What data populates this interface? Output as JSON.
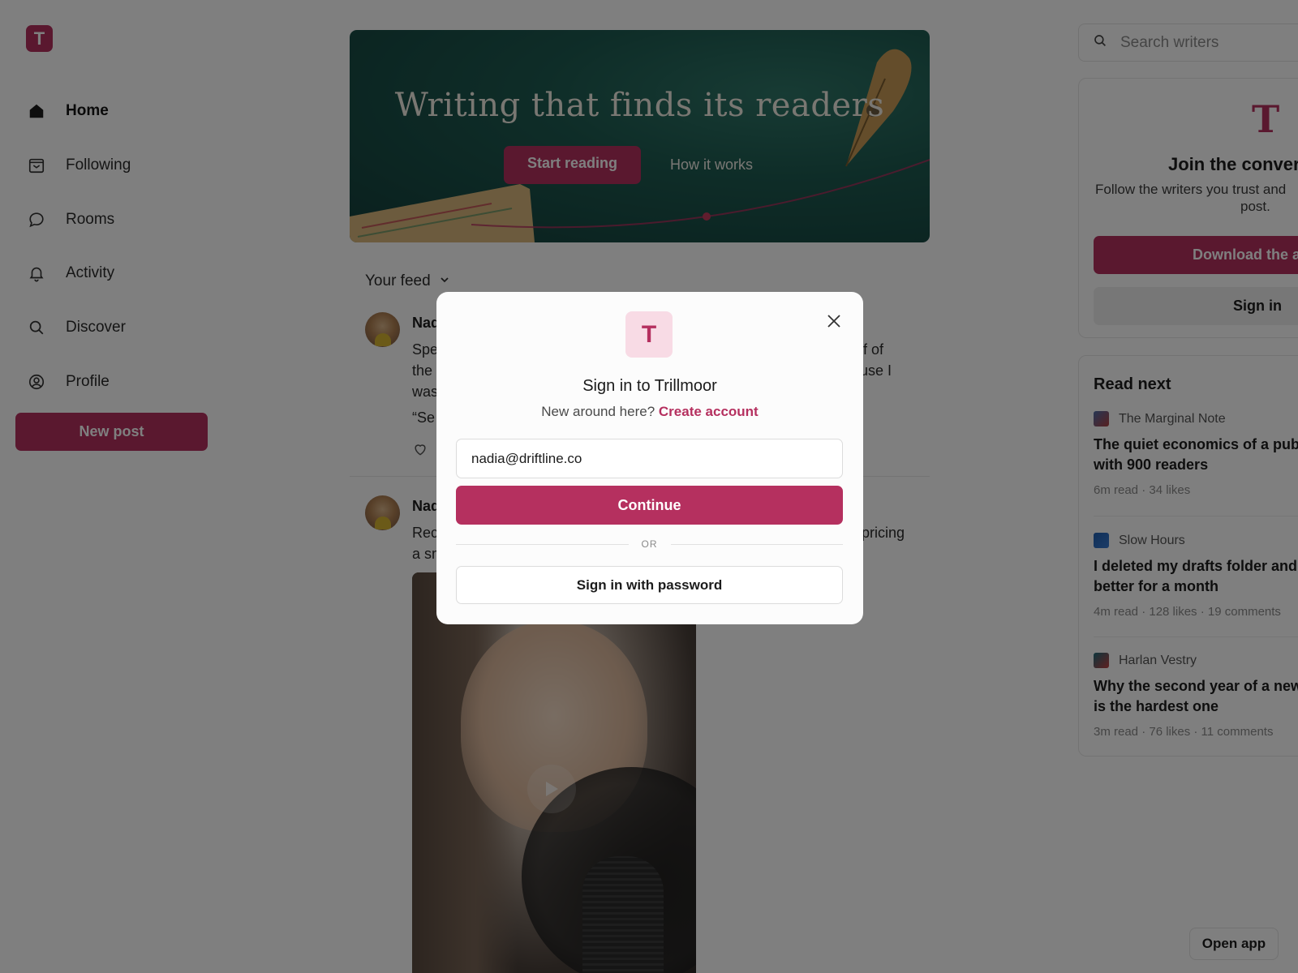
{
  "app": {
    "logo_letter": "T",
    "brand_color": "#b5305f"
  },
  "sidebar": {
    "items": [
      {
        "label": "Home",
        "icon": "home-icon",
        "active": true
      },
      {
        "label": "Following",
        "icon": "inbox-icon"
      },
      {
        "label": "Rooms",
        "icon": "chat-bubble-icon"
      },
      {
        "label": "Activity",
        "icon": "bell-icon"
      },
      {
        "label": "Discover",
        "icon": "search-icon"
      },
      {
        "label": "Profile",
        "icon": "user-circle-icon"
      }
    ],
    "new_post_label": "New post"
  },
  "hero": {
    "title": "Writing that finds its readers",
    "primary_button": "Start reading",
    "secondary_link": "How it works"
  },
  "feed": {
    "selector_label": "Your feed",
    "posts": [
      {
        "author": "Nadia",
        "text_lines": [
          "Spe",
          "the",
          "was"
        ],
        "text_right_lines": [
          "lf of",
          "use I"
        ],
        "quote": "“Se"
      },
      {
        "author": "Nadia",
        "text_lines": [
          "Rec",
          "a sm"
        ],
        "text_right_lines": [
          "pricing"
        ]
      }
    ]
  },
  "search": {
    "placeholder": "Search writers"
  },
  "join_card": {
    "logo_letter": "T",
    "title": "Join the convers",
    "subtitle_line1": "Follow the writers you trust and",
    "subtitle_line2": "post.",
    "download_label": "Download the a",
    "signin_label": "Sign in"
  },
  "read_next": {
    "title": "Read next",
    "items": [
      {
        "publication": "The Marginal Note",
        "headline_line1": "The quiet economics of a pub",
        "headline_line2": "with 900 readers",
        "meta": "6m read · 34 likes",
        "badge_color": "#8a3a5a"
      },
      {
        "publication": "Slow Hours",
        "headline_line1": "I deleted my drafts folder and",
        "headline_line2": "better for a month",
        "meta": "4m read · 128 likes · 19 comments",
        "badge_color": "#1f5fb0"
      },
      {
        "publication": "Harlan Vestry",
        "headline_line1": "Why the second year of a new",
        "headline_line2": "is the hardest one",
        "meta": "3m read · 76 likes · 11 comments",
        "badge_color": "#1d6b7a"
      }
    ]
  },
  "open_app_label": "Open app",
  "modal": {
    "logo_letter": "T",
    "title": "Sign in to Trillmoor",
    "subtitle_prefix": "New around here?",
    "create_account_label": "Create account",
    "email_value": "nadia@driftline.co",
    "continue_label": "Continue",
    "or_label": "OR",
    "password_button_label": "Sign in with password"
  }
}
